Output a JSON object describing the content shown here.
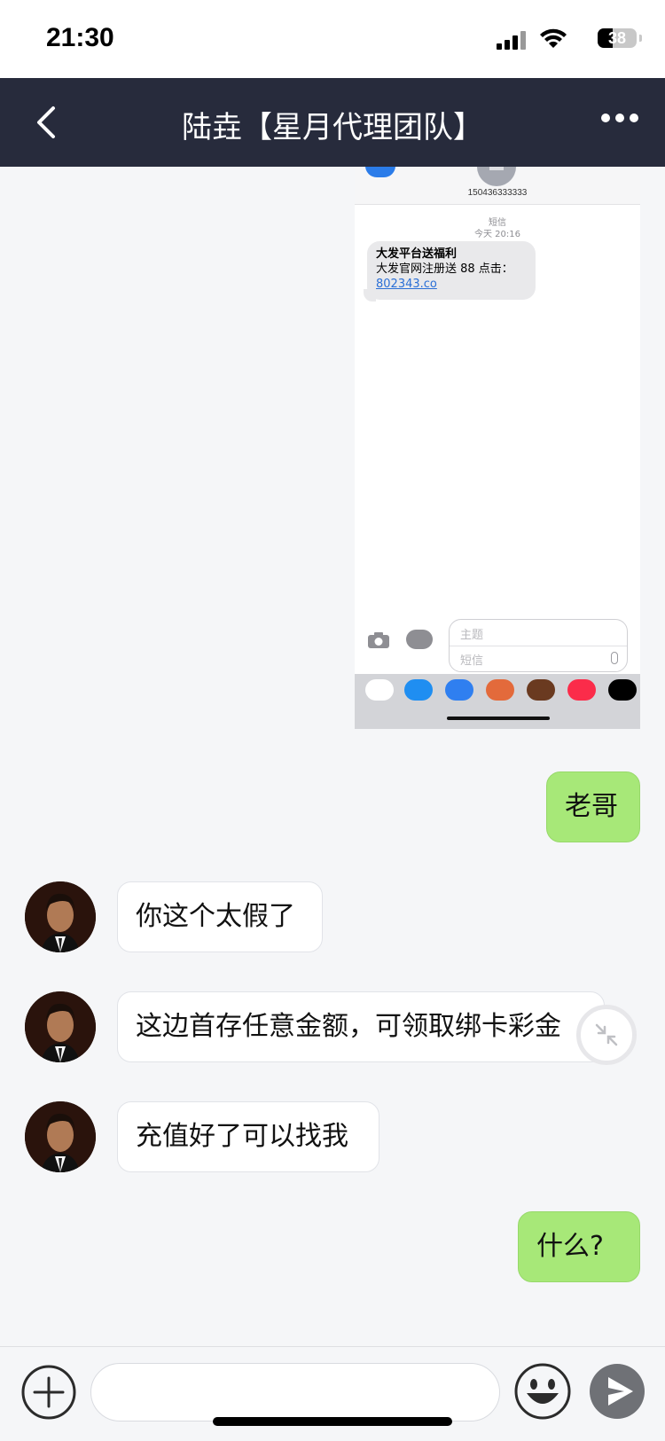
{
  "status_bar": {
    "time": "21:30",
    "battery": "38"
  },
  "header": {
    "title": "陆垚【星月代理团队】"
  },
  "shared_screenshot": {
    "phone": "150436333333",
    "meta_label": "短信",
    "meta_time": "今天 20:16",
    "sms_title": "大发平台送福利",
    "sms_body": "大发官网注册送 88 点击：",
    "sms_link": "802343.co",
    "subject_placeholder": "主题",
    "sms_placeholder": "短信"
  },
  "messages": [
    {
      "from": "me",
      "text": "老哥"
    },
    {
      "from": "them",
      "text": "你这个太假了"
    },
    {
      "from": "them",
      "text": "这边首存任意金额，可领取绑卡彩金"
    },
    {
      "from": "them",
      "text": "充值好了可以找我"
    },
    {
      "from": "me",
      "text": "什么?"
    }
  ],
  "colors": {
    "nav_bg": "#272b3c",
    "my_bubble": "#a7e878",
    "their_bubble": "#ffffff",
    "chat_bg": "#f5f6f8"
  },
  "icons": {
    "back": "chevron-left-icon",
    "more": "more-dots-icon",
    "plus": "plus-icon",
    "emoji": "smile-icon",
    "send": "send-icon",
    "collapse": "collapse-arrows-icon"
  }
}
